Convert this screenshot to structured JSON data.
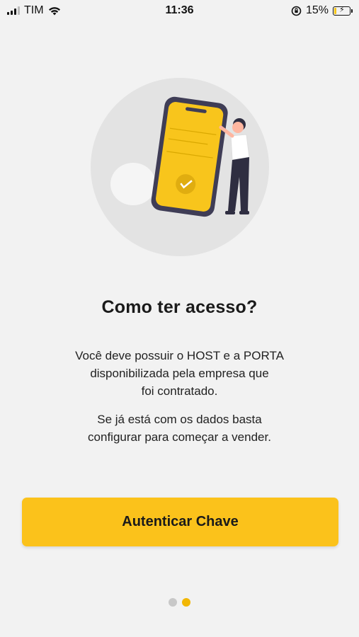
{
  "status_bar": {
    "carrier": "TIM",
    "time": "11:36",
    "battery_percent": "15%",
    "battery_level": 0.15,
    "icons": [
      "signal-icon",
      "wifi-icon",
      "orientation-lock-icon",
      "battery-charging-icon"
    ]
  },
  "illustration": {
    "description_icon": "phone-with-person-illustration"
  },
  "content": {
    "title": "Como ter acesso?",
    "paragraph1_lines": [
      "Você deve possuir o HOST e a PORTA",
      "disponibilizada pela empresa que",
      "foi contratado."
    ],
    "paragraph2_lines": [
      "Se já está com os dados basta",
      "configurar para começar a vender."
    ]
  },
  "button": {
    "label": "Autenticar Chave"
  },
  "pager": {
    "total": 2,
    "active_index": 1
  },
  "colors": {
    "accent": "#fbc21b",
    "background": "#f2f2f2",
    "dot_active": "#f2b705",
    "dot_inactive": "#c8c8c8"
  }
}
